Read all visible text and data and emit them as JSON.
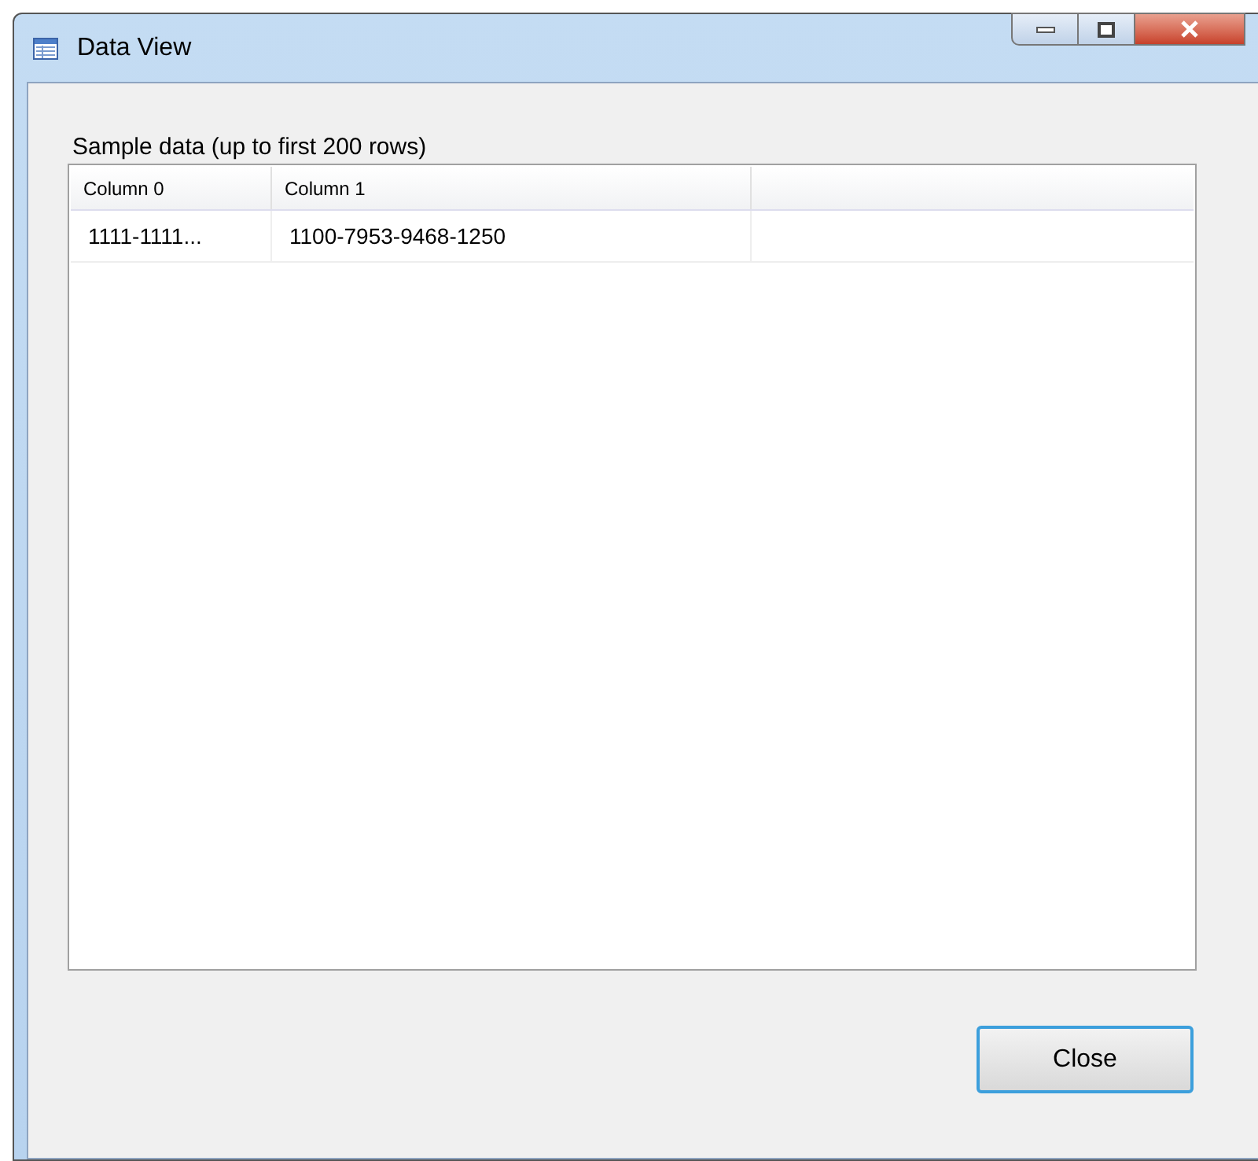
{
  "window": {
    "title": "Data View"
  },
  "caption": "Sample data (up to first 200 rows)",
  "table": {
    "columns": [
      "Column 0",
      "Column 1"
    ],
    "rows": [
      [
        "1111-1111...",
        "1100-7953-9468-1250"
      ]
    ]
  },
  "buttons": [
    "Close"
  ]
}
